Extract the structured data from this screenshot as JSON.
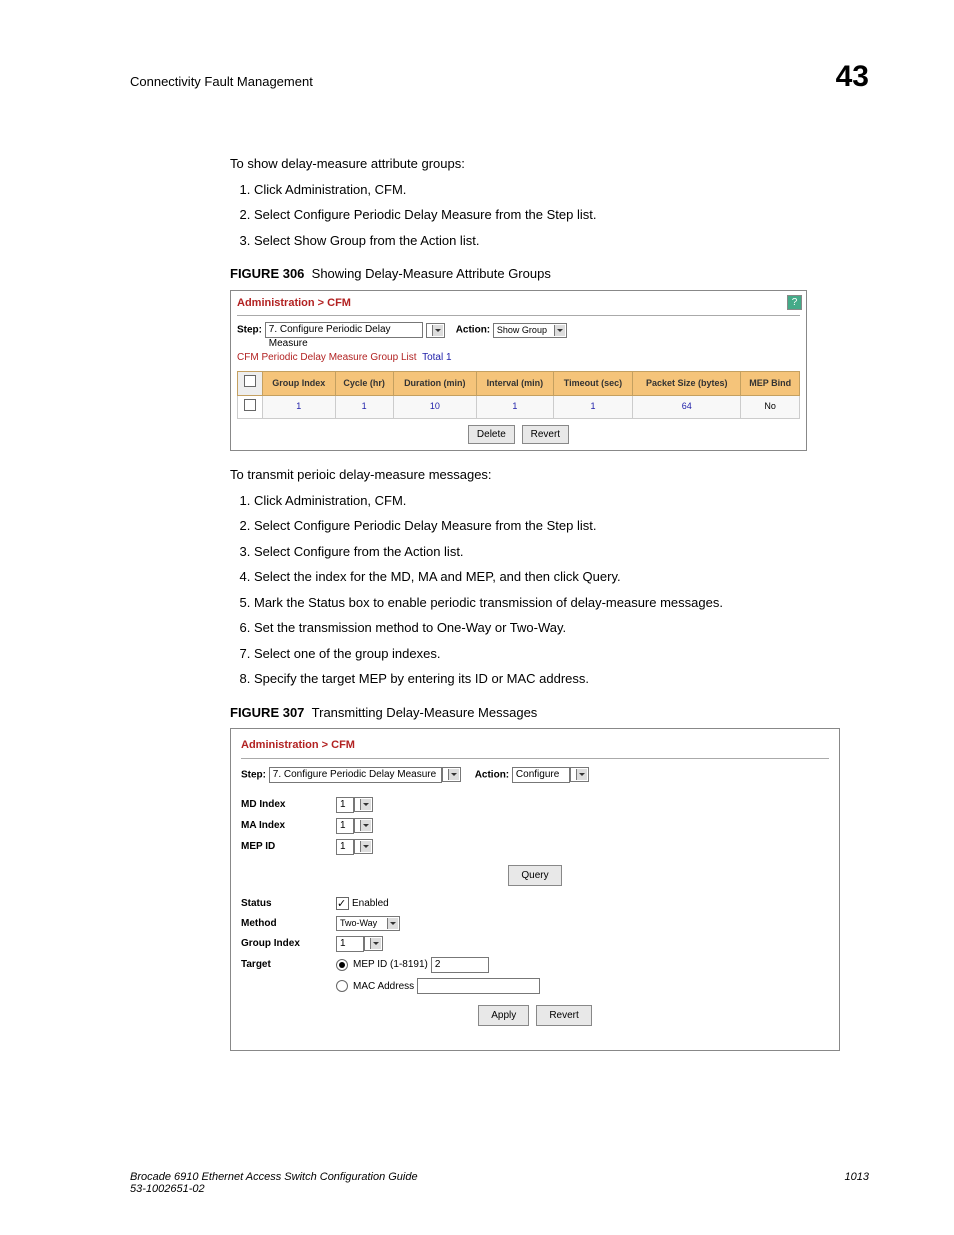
{
  "header": {
    "section": "Connectivity Fault Management",
    "chapter": "43"
  },
  "intro1": "To show delay-measure attribute groups:",
  "steps1": [
    "Click Administration, CFM.",
    "Select Configure Periodic Delay Measure from the Step list.",
    "Select Show Group from the Action list."
  ],
  "figure306": {
    "label": "FIGURE 306",
    "caption": "Showing Delay-Measure Attribute Groups",
    "breadcrumb": "Administration > CFM",
    "step_label": "Step:",
    "step_value": "7. Configure Periodic Delay Measure",
    "action_label": "Action:",
    "action_value": "Show Group",
    "list_title": "CFM Periodic Delay Measure Group List",
    "total_label": "Total 1",
    "columns": [
      "Group Index",
      "Cycle (hr)",
      "Duration (min)",
      "Interval (min)",
      "Timeout (sec)",
      "Packet Size (bytes)",
      "MEP Bind"
    ],
    "row": [
      "1",
      "1",
      "10",
      "1",
      "1",
      "64",
      "No"
    ],
    "btn_delete": "Delete",
    "btn_revert": "Revert"
  },
  "intro2": "To transmit perioic delay-measure messages:",
  "steps2": [
    "Click Administration, CFM.",
    "Select Configure Periodic Delay Measure from the Step list.",
    "Select Configure from the Action list.",
    "Select the index for the MD, MA and MEP, and then click Query.",
    "Mark the Status box to enable periodic transmission of delay-measure messages.",
    "Set the transmission method to One-Way or Two-Way.",
    "Select one of the group indexes.",
    "Specify the target MEP by entering its ID or MAC address."
  ],
  "figure307": {
    "label": "FIGURE 307",
    "caption": "Transmitting Delay-Measure Messages",
    "breadcrumb": "Administration > CFM",
    "step_label": "Step:",
    "step_value": "7. Configure Periodic Delay Measure",
    "action_label": "Action:",
    "action_value": "Configure",
    "md_index_lbl": "MD Index",
    "md_index_val": "1",
    "ma_index_lbl": "MA Index",
    "ma_index_val": "1",
    "mep_id_lbl": "MEP ID",
    "mep_id_val": "1",
    "btn_query": "Query",
    "status_lbl": "Status",
    "status_text": "Enabled",
    "method_lbl": "Method",
    "method_val": "Two-Way",
    "group_index_lbl": "Group Index",
    "group_index_val": "1",
    "target_lbl": "Target",
    "target_mep_lbl": "MEP ID (1-8191)",
    "target_mep_val": "2",
    "target_mac_lbl": "MAC Address",
    "btn_apply": "Apply",
    "btn_revert": "Revert"
  },
  "footer": {
    "left_line1": "Brocade 6910 Ethernet Access Switch Configuration Guide",
    "left_line2": "53-1002651-02",
    "right": "1013"
  }
}
